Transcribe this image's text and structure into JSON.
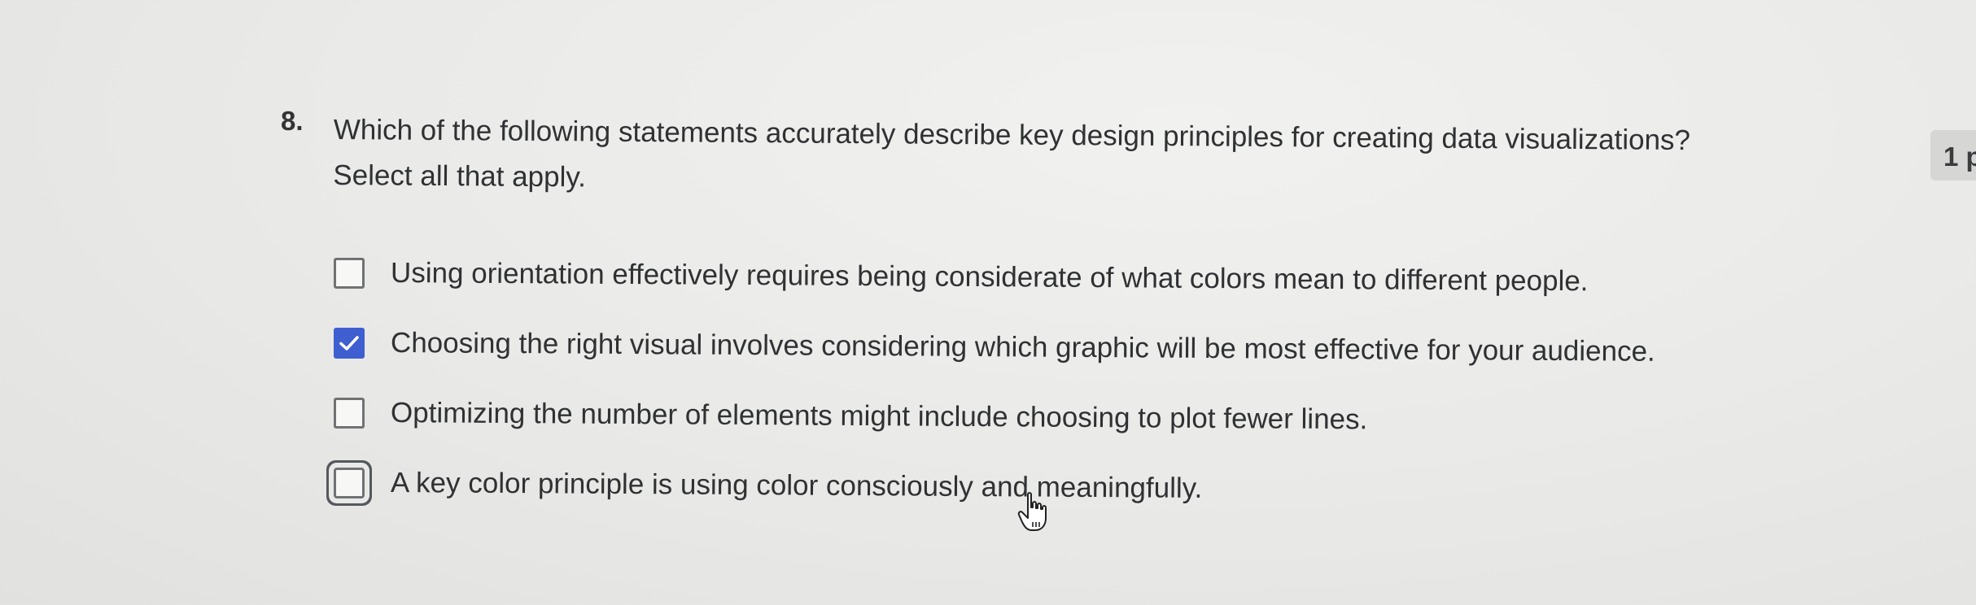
{
  "question": {
    "number": "8.",
    "text_line1": "Which of the following statements accurately describe key design principles for creating data visualizations?",
    "text_line2": "Select all that apply.",
    "options": [
      {
        "label": "Using orientation effectively requires being considerate of what colors mean to different people.",
        "checked": false
      },
      {
        "label": "Choosing the right visual involves considering which graphic will be most effective for your audience.",
        "checked": true
      },
      {
        "label": "Optimizing the number of elements might include choosing to plot fewer lines.",
        "checked": false
      },
      {
        "label": "A key color principle is using color consciously and meaningfully.",
        "checked": false,
        "focused": true
      }
    ]
  },
  "points_label": "1 p",
  "colors": {
    "checked_fill": "#3f5fd0",
    "text": "#2f3133"
  },
  "icons": {
    "checkmark": "checkmark-icon",
    "cursor": "hand-pointer-cursor-icon"
  }
}
